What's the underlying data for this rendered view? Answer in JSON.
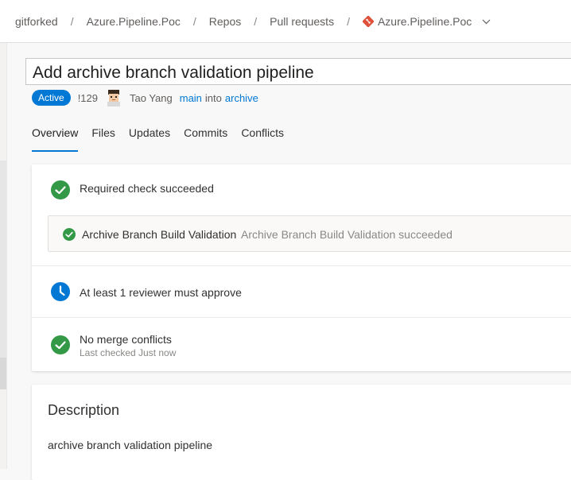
{
  "breadcrumb": {
    "items": [
      "gitforked",
      "Azure.Pipeline.Poc",
      "Repos",
      "Pull requests",
      "Azure.Pipeline.Poc"
    ],
    "separator": "/"
  },
  "pr": {
    "title": "Add archive branch validation pipeline",
    "status": "Active",
    "id": "!129",
    "author": "Tao Yang",
    "source_branch": "main",
    "into_text": "into",
    "target_branch": "archive"
  },
  "tabs": [
    "Overview",
    "Files",
    "Updates",
    "Commits",
    "Conflicts"
  ],
  "status_card": {
    "required_check": "Required check succeeded",
    "check_name": "Archive Branch Build Validation",
    "check_detail": "Archive Branch Build Validation succeeded",
    "reviewer_policy": "At least 1 reviewer must approve",
    "merge_status": "No merge conflicts",
    "merge_checked": "Last checked Just now"
  },
  "description": {
    "title": "Description",
    "body": "archive branch validation pipeline"
  },
  "colors": {
    "accent": "#0078d4",
    "success": "#339947",
    "git_icon": "#e0513b"
  },
  "icons": {
    "repo": "git-repo-icon",
    "chevron": "chevron-down-icon",
    "success": "check-circle-icon",
    "waiting": "clock-icon"
  }
}
